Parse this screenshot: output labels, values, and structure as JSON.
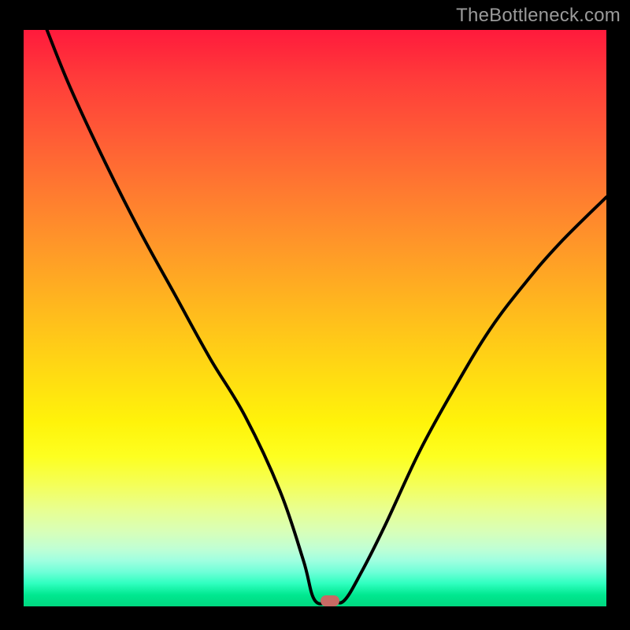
{
  "watermark": "TheBottleneck.com",
  "marker": {
    "x_pct": 52.5,
    "y_pct": 99.0
  },
  "chart_data": {
    "type": "line",
    "title": "",
    "xlabel": "",
    "ylabel": "",
    "xlim": [
      0,
      100
    ],
    "ylim": [
      0,
      100
    ],
    "grid": false,
    "legend": false,
    "series": [
      {
        "name": "bottleneck-curve",
        "x": [
          4,
          8,
          14,
          20,
          26,
          32,
          38,
          44,
          48,
          50,
          53,
          55,
          58,
          62,
          68,
          74,
          80,
          86,
          92,
          100
        ],
        "y": [
          100,
          90,
          77,
          65,
          54,
          43,
          33,
          20,
          8,
          1,
          1,
          1,
          6,
          14,
          27,
          38,
          48,
          56,
          63,
          71
        ]
      }
    ],
    "annotations": [
      {
        "type": "marker",
        "x": 52.5,
        "y": 1.0,
        "label": "optimal-point"
      }
    ],
    "background_gradient": {
      "direction": "vertical",
      "stops": [
        {
          "pct": 0,
          "color": "#ff1a3c"
        },
        {
          "pct": 50,
          "color": "#ffd000"
        },
        {
          "pct": 75,
          "color": "#faff30"
        },
        {
          "pct": 100,
          "color": "#00d880"
        }
      ]
    }
  }
}
